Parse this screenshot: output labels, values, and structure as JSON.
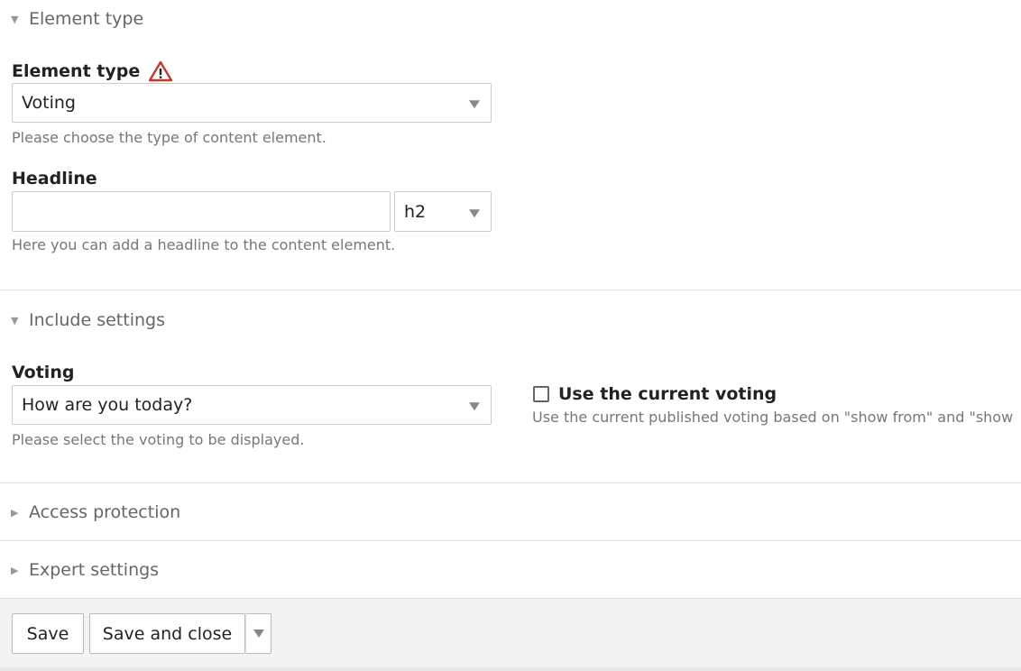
{
  "sections": {
    "element_type": {
      "legend": "Element type"
    },
    "include_settings": {
      "legend": "Include settings"
    },
    "access_protection": {
      "legend": "Access protection"
    },
    "expert_settings": {
      "legend": "Expert settings"
    }
  },
  "element_type_field": {
    "label": "Element type",
    "value": "Voting",
    "help": "Please choose the type of content element."
  },
  "headline_field": {
    "label": "Headline",
    "value": "",
    "level": "h2",
    "help": "Here you can add a headline to the content element."
  },
  "voting_field": {
    "label": "Voting",
    "value": "How are you today?",
    "help": "Please select the voting to be displayed."
  },
  "current_voting": {
    "label": "Use the current voting",
    "checked": false,
    "help": "Use the current published voting based on \"show from\" and \"show"
  },
  "footer": {
    "save": "Save",
    "save_close": "Save and close"
  },
  "colors": {
    "warning": "#c0392b",
    "muted_text": "#777777",
    "footer_bg": "#f3f3f3"
  },
  "icons": {
    "collapse_open": "triangle-down",
    "collapse_closed": "triangle-right",
    "warning": "warning-triangle"
  }
}
